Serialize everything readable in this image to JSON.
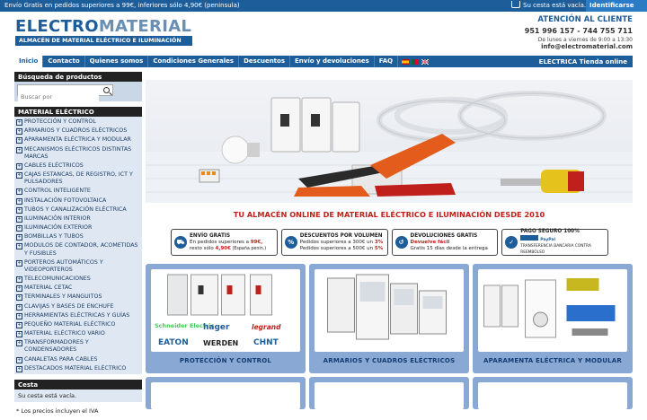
{
  "topbar": {
    "promo": "Envío Gratis en pedidos superiores a 99€, inferiores sólo 4,90€ (peninsula)",
    "cart": "Su cesta está vacía.",
    "login": "Identificarse"
  },
  "brand": {
    "logo_a": "ELECTRO",
    "logo_b": "MATERIAL",
    "tagline": "ALMACÉN DE MATERIAL ELÉCTRICO E ILUMINACIÓN"
  },
  "contact": {
    "heading": "ATENCIÓN AL CLIENTE",
    "phones": "951 996 157 - 744 755 711",
    "hours": "De lunes a viernes de 9:00 a 13:30",
    "email": "info@electromaterial.com"
  },
  "nav": {
    "items": [
      "Inicio",
      "Contacto",
      "Quienes somos",
      "Condiciones Generales",
      "Descuentos",
      "Envío y devoluciones",
      "FAQ"
    ],
    "right": "ELECTRICA Tienda online"
  },
  "sidebar": {
    "search_title": "Búsqueda de productos",
    "search_placeholder": "Buscar por",
    "cat_title": "MATERIAL ELÉCTRICO",
    "categories": [
      "PROTECCIÓN Y CONTROL",
      "ARMARIOS Y CUADROS ELÉCTRICOS",
      "APARAMENTA ELÉCTRICA Y MODULAR",
      "MECANISMOS ELÉCTRICOS DISTINTAS MARCAS",
      "CABLES ELÉCTRICOS",
      "CAJAS ESTANCAS, DE REGISTRO, ICT Y PULSADORES",
      "CONTROL INTELIGENTE",
      "INSTALACIÓN FOTOVOLTAICA",
      "TUBOS Y CANALIZACIÓN ELÉCTRICA",
      "ILUMINACIÓN INTERIOR",
      "ILUMINACIÓN EXTERIOR",
      "BOMBILLAS Y TUBOS",
      "MODULOS DE CONTADOR, ACOMETIDAS Y FUSIBLES",
      "PORTEROS AUTOMÁTICOS Y VIDEOPORTEROS",
      "TELECOMUNICACIONES",
      "MATERIAL CETAC",
      "TERMINALES Y MANGUITOS",
      "CLAVIJAS Y BASES DE ENCHUFE",
      "HERRAMIENTAS ELÉCTRICAS Y GUÍAS",
      "PEQUEÑO MATERIAL ELÉCTRICO",
      "MATERIAL ELÉCTRICO VARIO",
      "TRANSFORMADORES Y CONDENSADORES",
      "CANALETAS PARA CABLES",
      "DESTACADOS MATERIAL ELÉCTRICO"
    ],
    "cesta_title": "Cesta",
    "cesta_body": "Su cesta está vacía.",
    "iva_note": "* Los precios incluyen el IVA"
  },
  "slogan": "TU ALMACÉN ONLINE DE MATERIAL ELÉCTRICO E ILUMINACIÓN DESDE 2010",
  "features": [
    {
      "title": "ENVÍO GRATIS",
      "l1": "En pedidos superiores a ",
      "l1r": "99€,",
      "l2": "resto sólo ",
      "l2r": "4,90€",
      "l2b": " (España penin.)"
    },
    {
      "title": "DESCUENTOS POR VOLUMEN",
      "l1": "Pedidos superiores a 300€ un ",
      "l1r": "3%",
      "l2": "Pedidos superiores a 500€ un ",
      "l2r": "5%",
      "l2b": ""
    },
    {
      "title": "DEVOLUCIONES GRATIS",
      "l1": "",
      "l1r": "Devuelve fácil",
      "l2": "Gratis 15 días desde la entrega",
      "l2r": "",
      "l2b": ""
    },
    {
      "title": "PAGO SEGURO 100%",
      "l1": "",
      "l1r": "",
      "l2": "PayPal",
      "l2r": "",
      "l2b": "TRANSFERENCIA BANCARIA   CONTRA REEMBOLSO"
    }
  ],
  "cards": [
    {
      "caption": "PROTECCIÓN Y CONTROL",
      "brands": [
        "Schneider Electric",
        "hager",
        "legrand",
        "EATON",
        "WERDEN",
        "CHNT"
      ]
    },
    {
      "caption": "ARMARIOS Y CUADROS ELÉCTRICOS"
    },
    {
      "caption": "APARAMENTA ELÉCTRICA Y MODULAR"
    }
  ],
  "colors": {
    "primary": "#1d5d9a",
    "accent": "#c0201c",
    "card": "#8aa8d4"
  }
}
